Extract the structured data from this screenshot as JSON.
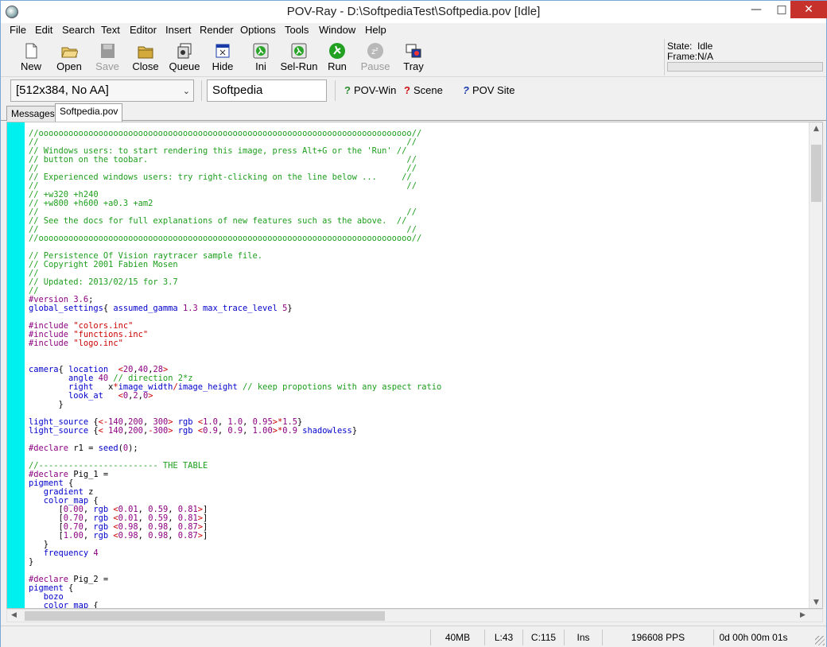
{
  "window": {
    "title": "POV-Ray - D:\\SoftpediaTest\\Softpedia.pov [Idle]"
  },
  "menu": [
    "File",
    "Edit",
    "Search",
    "Text",
    "Editor",
    "Insert",
    "Render",
    "Options",
    "Tools",
    "Window",
    "Help"
  ],
  "toolbar": {
    "new": "New",
    "open": "Open",
    "save": "Save",
    "close": "Close",
    "queue": "Queue",
    "hide": "Hide",
    "ini": "Ini",
    "selrun": "Sel-Run",
    "run": "Run",
    "pause": "Pause",
    "tray": "Tray"
  },
  "state": {
    "state_label": "State:",
    "state_value": "Idle",
    "frame_label": "Frame:",
    "frame_value": "N/A"
  },
  "toolbar2": {
    "resolution": "[512x384, No AA]",
    "file_field": "Softpedia",
    "povwin": "POV-Win",
    "scene": "Scene",
    "povsite": "POV Site"
  },
  "tabs": [
    "Messages",
    "Softpedia.pov"
  ],
  "status": {
    "memory": "40MB",
    "line": "L:43",
    "column": "C:115",
    "mode": "Ins",
    "pps": "196608 PPS",
    "time": "0d 00h 00m 01s"
  },
  "code_lines": [
    [
      [
        "c",
        "//ooooooooooooooooooooooooooooooooooooooooooooooooooooooooooooooooooooooooooo//"
      ]
    ],
    [
      [
        "c",
        "//                                                                          //"
      ]
    ],
    [
      [
        "c",
        "// Windows users: to start rendering this image, press Alt+G or the 'Run' //"
      ]
    ],
    [
      [
        "c",
        "// button on the toobar.                                                    //"
      ]
    ],
    [
      [
        "c",
        "//                                                                          //"
      ]
    ],
    [
      [
        "c",
        "// Experienced windows users: try right-clicking on the line below ...     //"
      ]
    ],
    [
      [
        "c",
        "//                                                                          //"
      ]
    ],
    [
      [
        "c",
        "// +w320 +h240"
      ]
    ],
    [
      [
        "c",
        "// +w800 +h600 +a0.3 +am2"
      ]
    ],
    [
      [
        "c",
        "//                                                                          //"
      ]
    ],
    [
      [
        "c",
        "// See the docs for full explanations of new features such as the above.  //"
      ]
    ],
    [
      [
        "c",
        "//                                                                          //"
      ]
    ],
    [
      [
        "c",
        "//ooooooooooooooooooooooooooooooooooooooooooooooooooooooooooooooooooooooooooo//"
      ]
    ],
    [
      [
        "t",
        ""
      ]
    ],
    [
      [
        "c",
        "// Persistence Of Vision raytracer sample file."
      ]
    ],
    [
      [
        "c",
        "// Copyright 2001 Fabien Mosen"
      ]
    ],
    [
      [
        "c",
        "//"
      ]
    ],
    [
      [
        "c",
        "// Updated: 2013/02/15 for 3.7"
      ]
    ],
    [
      [
        "c",
        "//"
      ]
    ],
    [
      [
        "m",
        "#version "
      ],
      [
        "n",
        "3.6"
      ],
      [
        "t",
        ";"
      ]
    ],
    [
      [
        "k",
        "global_settings"
      ],
      [
        "t",
        "{ "
      ],
      [
        "k",
        "assumed_gamma "
      ],
      [
        "n",
        "1.3 "
      ],
      [
        "k",
        "max_trace_level "
      ],
      [
        "n",
        "5"
      ],
      [
        "t",
        "}"
      ]
    ],
    [
      [
        "t",
        ""
      ]
    ],
    [
      [
        "m",
        "#include "
      ],
      [
        "s",
        "\"colors.inc\""
      ]
    ],
    [
      [
        "m",
        "#include "
      ],
      [
        "s",
        "\"functions.inc\""
      ]
    ],
    [
      [
        "m",
        "#include "
      ],
      [
        "s",
        "\"logo.inc\""
      ]
    ],
    [
      [
        "t",
        ""
      ]
    ],
    [
      [
        "t",
        ""
      ]
    ],
    [
      [
        "k",
        "camera"
      ],
      [
        "t",
        "{ "
      ],
      [
        "k",
        "location  "
      ],
      [
        "p",
        "<"
      ],
      [
        "n",
        "20"
      ],
      [
        "t",
        ","
      ],
      [
        "n",
        "40"
      ],
      [
        "t",
        ","
      ],
      [
        "n",
        "28"
      ],
      [
        "p",
        ">"
      ]
    ],
    [
      [
        "t",
        "        "
      ],
      [
        "k",
        "angle "
      ],
      [
        "n",
        "40 "
      ],
      [
        "c",
        "// direction 2*z"
      ]
    ],
    [
      [
        "t",
        "        "
      ],
      [
        "k",
        "right   "
      ],
      [
        "t",
        "x"
      ],
      [
        "p",
        "*"
      ],
      [
        "k",
        "image_width"
      ],
      [
        "p",
        "/"
      ],
      [
        "k",
        "image_height "
      ],
      [
        "c",
        "// keep propotions with any aspect ratio"
      ]
    ],
    [
      [
        "t",
        "        "
      ],
      [
        "k",
        "look_at   "
      ],
      [
        "p",
        "<"
      ],
      [
        "n",
        "0"
      ],
      [
        "t",
        ","
      ],
      [
        "n",
        "2"
      ],
      [
        "t",
        ","
      ],
      [
        "n",
        "0"
      ],
      [
        "p",
        ">"
      ]
    ],
    [
      [
        "t",
        "      }"
      ]
    ],
    [
      [
        "t",
        ""
      ]
    ],
    [
      [
        "k",
        "light_source "
      ],
      [
        "t",
        "{"
      ],
      [
        "p",
        "<"
      ],
      [
        "p",
        "-"
      ],
      [
        "n",
        "140"
      ],
      [
        "t",
        ","
      ],
      [
        "n",
        "200"
      ],
      [
        "t",
        ", "
      ],
      [
        "n",
        "300"
      ],
      [
        "p",
        ">"
      ],
      [
        "t",
        " "
      ],
      [
        "k",
        "rgb "
      ],
      [
        "p",
        "<"
      ],
      [
        "n",
        "1.0"
      ],
      [
        "t",
        ", "
      ],
      [
        "n",
        "1.0"
      ],
      [
        "t",
        ", "
      ],
      [
        "n",
        "0.95"
      ],
      [
        "p",
        ">*"
      ],
      [
        "n",
        "1.5"
      ],
      [
        "t",
        "}"
      ]
    ],
    [
      [
        "k",
        "light_source "
      ],
      [
        "t",
        "{"
      ],
      [
        "p",
        "< "
      ],
      [
        "n",
        "140"
      ],
      [
        "t",
        ","
      ],
      [
        "n",
        "200"
      ],
      [
        "t",
        ","
      ],
      [
        "p",
        "-"
      ],
      [
        "n",
        "300"
      ],
      [
        "p",
        ">"
      ],
      [
        "t",
        " "
      ],
      [
        "k",
        "rgb "
      ],
      [
        "p",
        "<"
      ],
      [
        "n",
        "0.9"
      ],
      [
        "t",
        ", "
      ],
      [
        "n",
        "0.9"
      ],
      [
        "t",
        ", "
      ],
      [
        "n",
        "1.00"
      ],
      [
        "p",
        ">*"
      ],
      [
        "n",
        "0.9 "
      ],
      [
        "k",
        "shadowless"
      ],
      [
        "t",
        "}"
      ]
    ],
    [
      [
        "t",
        ""
      ]
    ],
    [
      [
        "m",
        "#declare "
      ],
      [
        "t",
        "r1 = "
      ],
      [
        "k",
        "seed"
      ],
      [
        "t",
        "("
      ],
      [
        "n",
        "0"
      ],
      [
        "t",
        ");"
      ]
    ],
    [
      [
        "t",
        ""
      ]
    ],
    [
      [
        "c",
        "//------------------------ THE TABLE"
      ]
    ],
    [
      [
        "m",
        "#declare "
      ],
      [
        "t",
        "Pig_1 ="
      ]
    ],
    [
      [
        "k",
        "pigment "
      ],
      [
        "t",
        "{"
      ]
    ],
    [
      [
        "t",
        "   "
      ],
      [
        "k",
        "gradient "
      ],
      [
        "t",
        "z"
      ]
    ],
    [
      [
        "t",
        "   "
      ],
      [
        "k",
        "color_map "
      ],
      [
        "t",
        "{"
      ]
    ],
    [
      [
        "t",
        "      ["
      ],
      [
        "n",
        "0.00"
      ],
      [
        "t",
        ", "
      ],
      [
        "k",
        "rgb "
      ],
      [
        "p",
        "<"
      ],
      [
        "n",
        "0.01"
      ],
      [
        "t",
        ", "
      ],
      [
        "n",
        "0.59"
      ],
      [
        "t",
        ", "
      ],
      [
        "n",
        "0.81"
      ],
      [
        "p",
        ">"
      ],
      [
        "t",
        "]"
      ]
    ],
    [
      [
        "t",
        "      ["
      ],
      [
        "n",
        "0.70"
      ],
      [
        "t",
        ", "
      ],
      [
        "k",
        "rgb "
      ],
      [
        "p",
        "<"
      ],
      [
        "n",
        "0.01"
      ],
      [
        "t",
        ", "
      ],
      [
        "n",
        "0.59"
      ],
      [
        "t",
        ", "
      ],
      [
        "n",
        "0.81"
      ],
      [
        "p",
        ">"
      ],
      [
        "t",
        "]"
      ]
    ],
    [
      [
        "t",
        "      ["
      ],
      [
        "n",
        "0.70"
      ],
      [
        "t",
        ", "
      ],
      [
        "k",
        "rgb "
      ],
      [
        "p",
        "<"
      ],
      [
        "n",
        "0.98"
      ],
      [
        "t",
        ", "
      ],
      [
        "n",
        "0.98"
      ],
      [
        "t",
        ", "
      ],
      [
        "n",
        "0.87"
      ],
      [
        "p",
        ">"
      ],
      [
        "t",
        "]"
      ]
    ],
    [
      [
        "t",
        "      ["
      ],
      [
        "n",
        "1.00"
      ],
      [
        "t",
        ", "
      ],
      [
        "k",
        "rgb "
      ],
      [
        "p",
        "<"
      ],
      [
        "n",
        "0.98"
      ],
      [
        "t",
        ", "
      ],
      [
        "n",
        "0.98"
      ],
      [
        "t",
        ", "
      ],
      [
        "n",
        "0.87"
      ],
      [
        "p",
        ">"
      ],
      [
        "t",
        "]"
      ]
    ],
    [
      [
        "t",
        "   }"
      ]
    ],
    [
      [
        "t",
        "   "
      ],
      [
        "k",
        "frequency "
      ],
      [
        "n",
        "4"
      ]
    ],
    [
      [
        "t",
        "}"
      ]
    ],
    [
      [
        "t",
        ""
      ]
    ],
    [
      [
        "m",
        "#declare "
      ],
      [
        "t",
        "Pig_2 ="
      ]
    ],
    [
      [
        "k",
        "pigment "
      ],
      [
        "t",
        "{"
      ]
    ],
    [
      [
        "t",
        "   "
      ],
      [
        "k",
        "bozo"
      ]
    ],
    [
      [
        "t",
        "   "
      ],
      [
        "k",
        "color_map "
      ],
      [
        "t",
        "{"
      ]
    ]
  ]
}
